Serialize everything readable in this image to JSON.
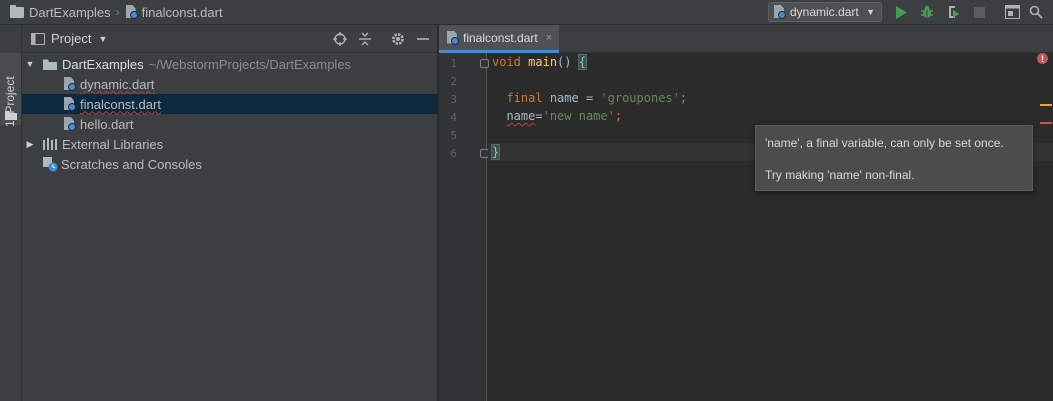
{
  "breadcrumb": {
    "project": "DartExamples",
    "file": "finalconst.dart"
  },
  "run_config": {
    "label": "dynamic.dart"
  },
  "icons": {
    "run": "run-icon",
    "debug": "debug-icon",
    "coverage": "coverage-icon",
    "stop": "stop-icon",
    "project_structure": "project-structure-icon",
    "search_everywhere": "search-icon"
  },
  "colors": {
    "run_green": "#499c54",
    "accent_blue": "#4a88c7",
    "error_red": "#c75450",
    "warning_orange": "#f0a732",
    "selection": "#0d293e"
  },
  "tool_strip": {
    "project_tab": "1: Project"
  },
  "project_panel": {
    "title": "Project",
    "tree": [
      {
        "label": "DartExamples",
        "hint": "~/WebstormProjects/DartExamples",
        "kind": "folder",
        "expanded": true
      },
      {
        "label": "dynamic.dart",
        "kind": "dart"
      },
      {
        "label": "finalconst.dart",
        "kind": "dart",
        "selected": true
      },
      {
        "label": "hello.dart",
        "kind": "dart"
      },
      {
        "label": "External Libraries",
        "kind": "libraries",
        "expanded": false
      },
      {
        "label": "Scratches and Consoles",
        "kind": "scratches"
      }
    ]
  },
  "editor": {
    "tab": {
      "label": "finalconst.dart",
      "close": "×"
    },
    "line_numbers": [
      "1",
      "2",
      "3",
      "4",
      "5",
      "6"
    ],
    "code": {
      "l1_kw": "void",
      "l1_fn": "main",
      "l1_rest": "() ",
      "l1_brace": "{",
      "l3_kw": "final",
      "l3_var": "name",
      "l3_eq": " = ",
      "l3_str": "'groupones'",
      "l3_end": ";",
      "l4_var": "name",
      "l4_eq": "=",
      "l4_str": "'new name'",
      "l4_end": ";",
      "l6_brace": "}"
    },
    "error_badge": "!"
  },
  "tooltip": {
    "line1": "'name', a final variable, can only be set once.",
    "line2": "Try making 'name' non-final."
  }
}
